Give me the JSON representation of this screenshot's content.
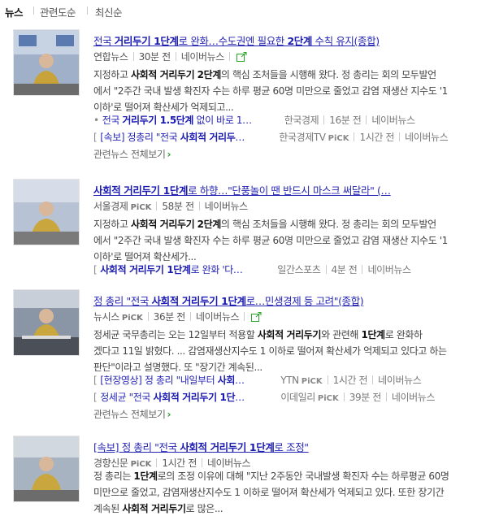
{
  "tabs": [
    "뉴스",
    "관련도순",
    "최신순"
  ],
  "common": {
    "naver": "네이버뉴스",
    "pick": "PiCK",
    "more": "관련뉴스 전체보기",
    "chev": "›"
  },
  "articles": [
    {
      "title_pre": "전국 ",
      "title_b1": "거리두기 1단계",
      "title_mid": "로 완화…수도권엔 필요한 ",
      "title_b2": "2단계",
      "title_post": " 수칙 유지(종합)",
      "source": "연합뉴스",
      "time": "30분 전",
      "desc_lines": [
        [
          "지정하고 ",
          "사회적 거리두기",
          " ",
          "2단계",
          "의 핵심 조처들을 시행해 왔다. 정 총리는 회의 모두발언"
        ],
        [
          "에서 \"2주간 국내 발생 확진자 수는 하루 평균 60명 미만으로 줄었고 감염 재생산 지수도 '1"
        ],
        [
          "이하'로 떨어져 확산세가 억제되고..."
        ]
      ],
      "related": [
        {
          "pre": "전국 ",
          "b": "거리두기 1.5단계",
          "post": " 없이 바로 1…",
          "source": "한국경제",
          "pick": "",
          "time": "16분 전",
          "bracket": false
        },
        {
          "pre": "[속보] 정총리 \"전국 ",
          "b": "사회적 거리두",
          "post": "…",
          "source": "한국경제TV",
          "pick": "PiCK",
          "time": "1시간 전",
          "bracket": true
        }
      ],
      "has_more": true
    },
    {
      "title_pre": "",
      "title_b1": "사회적 거리두기 1단계",
      "title_mid": "로 하향…\"단풍놀이 땐 반드시 마스크 써달라\" (…",
      "title_b2": "",
      "title_post": "",
      "source": "서울경제",
      "time": "58분 전",
      "desc_lines": [
        [
          "지정하고 ",
          "사회적 거리두기",
          " ",
          "2단계",
          "의 핵심 조처들을 시행해 왔다. 정 총리는 회의 모두발언"
        ],
        [
          "에서 \"2주간 국내 발생 확진자 수는 하루 평균 60명 미만으로 줄었고 감염 재생산 지수도 '1"
        ],
        [
          "이하'로 떨어져 확산세가..."
        ]
      ],
      "related": [
        {
          "pre": "",
          "b": "사회적 거리두기 1단계",
          "post": "로 완화 '다…",
          "source": "일간스포츠",
          "pick": "",
          "time": "4분 전",
          "bracket": true
        }
      ],
      "has_more": false
    },
    {
      "title_pre": "정 총리 \"전국 ",
      "title_b1": "사회적 거리두기 1단계",
      "title_mid": "로…민생경제 등 고려\"(종합)",
      "title_b2": "",
      "title_post": "",
      "source": "뉴시스",
      "time": "36분 전",
      "desc_lines": [
        [
          "정세균 국무총리는 오는 12일부터 적용할 ",
          "사회적 거리두기",
          "와 관련해 ",
          "1단계",
          "로 완화하"
        ],
        [
          "겠다고 11일 밝혔다. ... 감염재생산지수도 1 이하로 떨어져 확산세가 억제되고 있다고 하는"
        ],
        [
          "판단\"이라고 설명했다. 또 \"장기간 계속된..."
        ]
      ],
      "related": [
        {
          "pre": "[현장영상] 정 총리 \"내일부터 ",
          "b": "사회",
          "post": "…",
          "source": "YTN",
          "pick": "PiCK",
          "time": "1시간 전",
          "bracket": true
        },
        {
          "pre": "정세균 \"전국 ",
          "b": "사회적 거리두기 1단",
          "post": "…",
          "source": "이데일리",
          "pick": "PiCK",
          "time": "39분 전",
          "bracket": true
        }
      ],
      "has_more": true
    },
    {
      "title_pre": "[속보] 정 총리 \"전국 ",
      "title_b1": "사회적 거리두기 1단계",
      "title_mid": "로 조정\"",
      "title_b2": "",
      "title_post": "",
      "source": "경향신문",
      "time": "1시간 전",
      "desc_lines": [
        [
          "정 총리는 ",
          "1단계",
          "로의 조정 이유에 대해 \"지난 2주동안 국내발생 확진자 수는 하루평균 60명",
          "",
          ""
        ],
        [
          "미만으로 줄었고, 감염재생산지수도 1 이하로 떨어져 확산세가 억제되고 있다. 또한 장기간"
        ],
        [
          "계속된 ",
          "사회적 거리두기",
          "로 많은...",
          "",
          ""
        ]
      ],
      "related": [],
      "has_more": false
    }
  ]
}
